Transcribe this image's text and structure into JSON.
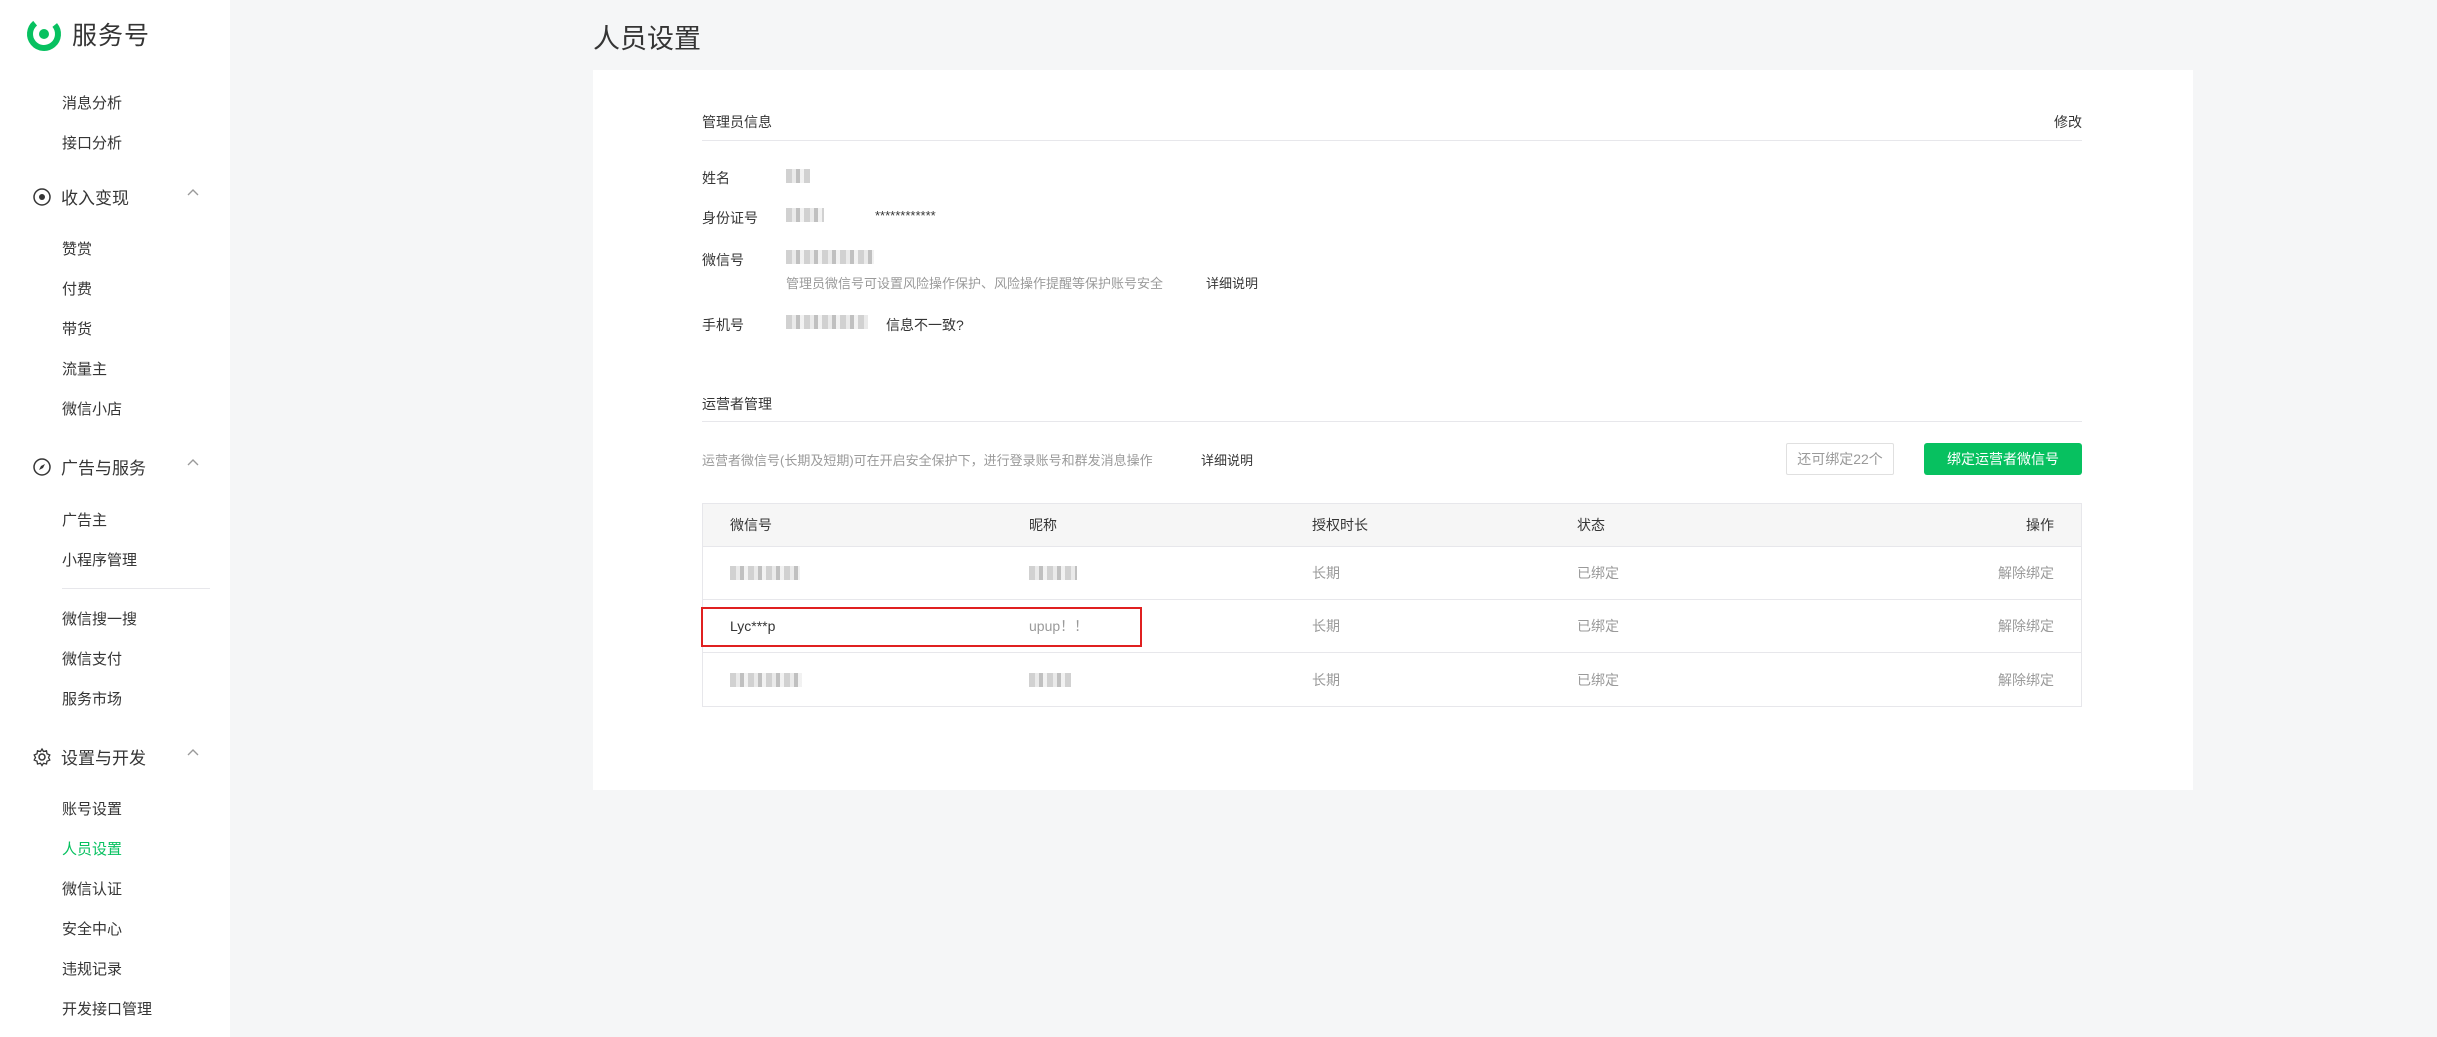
{
  "app": {
    "name": "服务号"
  },
  "sidebar": {
    "top_items": [
      {
        "label": "消息分析"
      },
      {
        "label": "接口分析"
      }
    ],
    "groups": [
      {
        "label": "收入变现",
        "icon": "money-circle-icon",
        "items": [
          {
            "label": "赞赏"
          },
          {
            "label": "付费"
          },
          {
            "label": "带货"
          },
          {
            "label": "流量主"
          },
          {
            "label": "微信小店"
          }
        ]
      },
      {
        "label": "广告与服务",
        "icon": "compass-icon",
        "items": [
          {
            "label": "广告主"
          },
          {
            "label": "小程序管理"
          }
        ],
        "extra_items": [
          {
            "label": "微信搜一搜"
          },
          {
            "label": "微信支付"
          },
          {
            "label": "服务市场"
          }
        ]
      },
      {
        "label": "设置与开发",
        "icon": "gear-icon",
        "items": [
          {
            "label": "账号设置"
          },
          {
            "label": "人员设置"
          },
          {
            "label": "微信认证"
          },
          {
            "label": "安全中心"
          },
          {
            "label": "违规记录"
          },
          {
            "label": "开发接口管理"
          }
        ]
      }
    ],
    "active_item": "人员设置"
  },
  "page": {
    "title": "人员设置"
  },
  "admin": {
    "section_title": "管理员信息",
    "edit_label": "修改",
    "name_label": "姓名",
    "id_label": "身份证号",
    "id_value_suffix": "************",
    "wechat_label": "微信号",
    "wechat_hint": "管理员微信号可设置风险操作保护、风险操作提醒等保护账号安全",
    "wechat_detail_link": "详细说明",
    "phone_label": "手机号",
    "phone_mismatch_link": "信息不一致?"
  },
  "operators": {
    "section_title": "运营者管理",
    "description": "运营者微信号(长期及短期)可在开启安全保护下，进行登录账号和群发消息操作",
    "detail_link": "详细说明",
    "remaining": "还可绑定22个",
    "bind_button": "绑定运营者微信号",
    "columns": {
      "wechat_id": "微信号",
      "nickname": "昵称",
      "duration": "授权时长",
      "status": "状态",
      "action": "操作"
    },
    "rows": [
      {
        "wechat_id": "",
        "nickname": "",
        "duration": "长期",
        "status": "已绑定",
        "action": "解除绑定"
      },
      {
        "wechat_id": "Lyc***p",
        "nickname": "upup！！",
        "duration": "长期",
        "status": "已绑定",
        "action": "解除绑定"
      },
      {
        "wechat_id": "",
        "nickname": "",
        "duration": "长期",
        "status": "已绑定",
        "action": "解除绑定"
      }
    ]
  },
  "colors": {
    "accent": "#07c160",
    "link": "#576b95",
    "highlight": "#e02020"
  }
}
